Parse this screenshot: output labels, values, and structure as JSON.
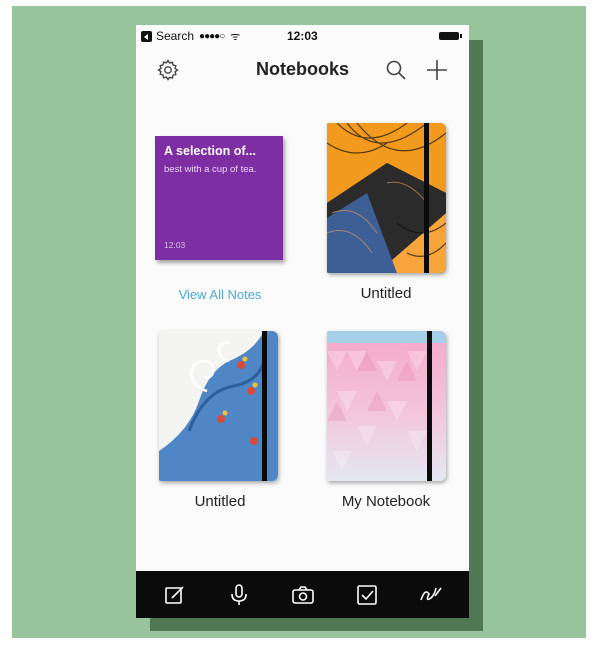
{
  "status_bar": {
    "back_label": "Search",
    "signal": "●●●●○",
    "wifi": "ᯤ",
    "time": "12:03"
  },
  "nav": {
    "title": "Notebooks",
    "icons": [
      "gear-icon",
      "search-icon",
      "plus-icon"
    ]
  },
  "notes_card": {
    "title": "A selection of...",
    "body": "best with a cup of tea.",
    "time": "12:03",
    "color": "#7d2ea3",
    "link": "View All Notes",
    "link_color": "#4ea7d9"
  },
  "notebooks": [
    {
      "label": "Untitled",
      "cover": "orange-black-pattern"
    },
    {
      "label": "Untitled",
      "cover": "blue-wave-pattern"
    },
    {
      "label": "My Notebook",
      "cover": "pink-triangle-pattern"
    }
  ],
  "tab_bar": {
    "items": [
      "edit-icon",
      "microphone-icon",
      "camera-icon",
      "checkbox-icon",
      "handwriting-icon"
    ]
  },
  "colors": {
    "background": "#97c49b",
    "tab_bar": "#0b0b0b"
  }
}
